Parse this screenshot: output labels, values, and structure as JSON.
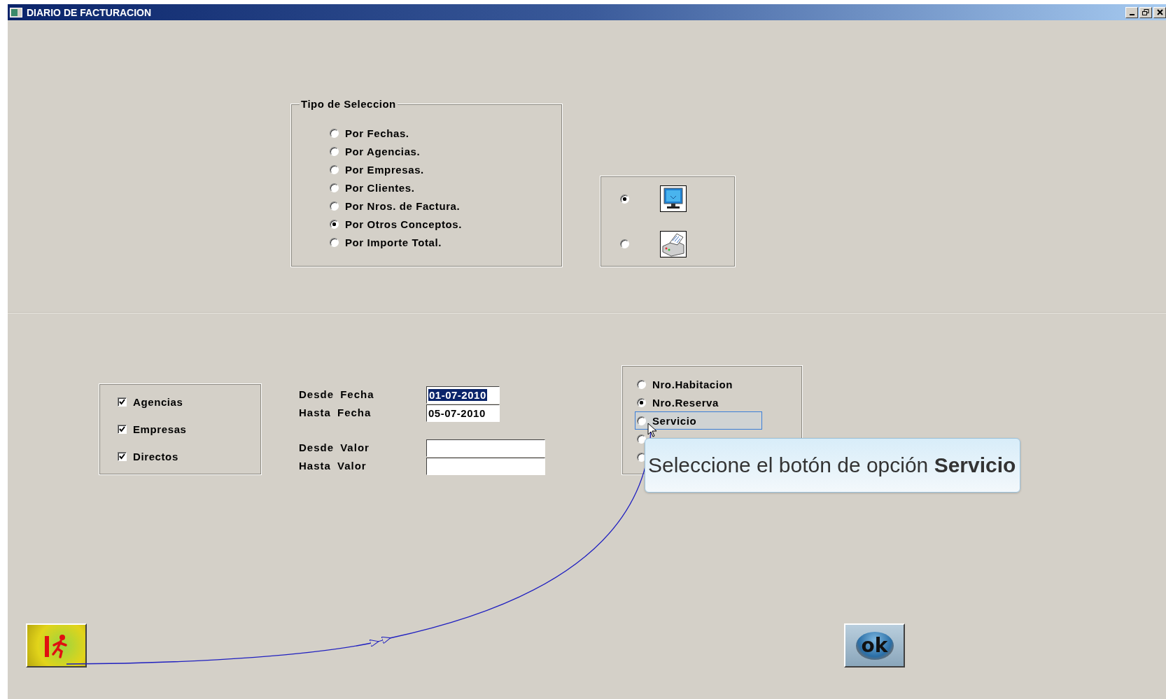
{
  "window": {
    "title": "DIARIO DE FACTURACION"
  },
  "selection_type": {
    "legend": "Tipo de Seleccion",
    "options": [
      {
        "label": "Por Fechas.",
        "selected": false
      },
      {
        "label": "Por Agencias.",
        "selected": false
      },
      {
        "label": "Por Empresas.",
        "selected": false
      },
      {
        "label": "Por Clientes.",
        "selected": false
      },
      {
        "label": "Por Nros. de Factura.",
        "selected": false
      },
      {
        "label": "Por Otros Conceptos.",
        "selected": true
      },
      {
        "label": "Por Importe Total.",
        "selected": false
      }
    ]
  },
  "output": {
    "options": [
      {
        "kind": "screen",
        "selected": true
      },
      {
        "kind": "printer",
        "selected": false
      }
    ]
  },
  "groups": [
    {
      "label": "Agencias",
      "checked": true
    },
    {
      "label": "Empresas",
      "checked": true
    },
    {
      "label": "Directos",
      "checked": true
    }
  ],
  "ranges": [
    {
      "label": "Desde Fecha",
      "value": "01-07-2010",
      "selected": true,
      "kind": "date"
    },
    {
      "label": "Hasta Fecha",
      "value": "05-07-2010",
      "selected": false,
      "kind": "date"
    },
    {
      "label": "Desde Valor",
      "selected": false,
      "kind": "amount"
    },
    {
      "label": "Hasta Valor",
      "selected": false,
      "kind": "amount"
    }
  ],
  "sort_by": {
    "options": [
      {
        "label": "Nro.Habitacion",
        "selected": false,
        "focused": false
      },
      {
        "label": "Nro.Reserva",
        "selected": true,
        "focused": false
      },
      {
        "label": "Servicio",
        "selected": false,
        "focused": true
      },
      {
        "selected": false,
        "focused": false
      },
      {
        "selected": false,
        "focused": false
      }
    ]
  },
  "tooltip": {
    "text": "Seleccione el botón de opción **Servicio**"
  },
  "buttons": [
    {
      "kind": "exit"
    },
    {
      "kind": "ok",
      "label": "ok"
    }
  ]
}
